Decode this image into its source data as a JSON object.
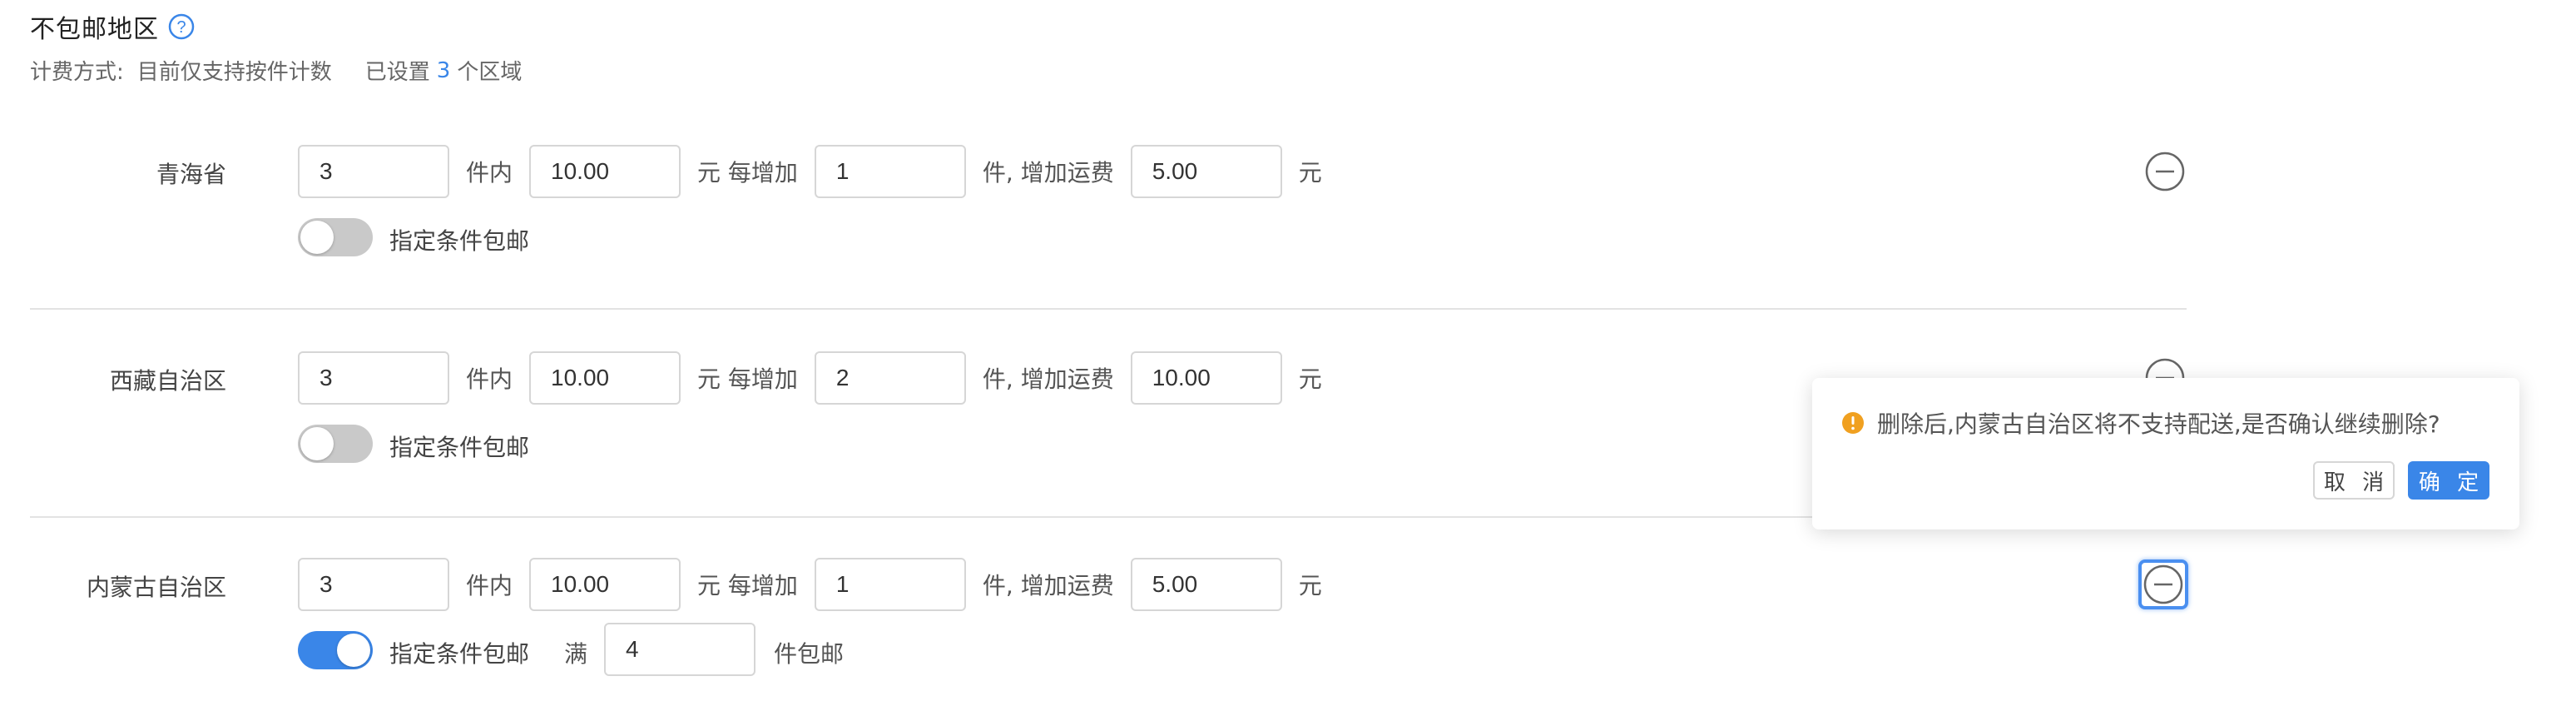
{
  "header": {
    "title": "不包邮地区",
    "help_icon": "question-circle-icon",
    "billing_label": "计费方式:",
    "billing_value": "目前仅支持按件计数",
    "set_prefix": "已设置",
    "set_count": "3",
    "set_suffix": "个区域"
  },
  "labels": {
    "within": "件内",
    "yuan_each": "元 每增加",
    "piece_add": "件, 增加运费",
    "yuan": "元",
    "free_toggle": "指定条件包邮",
    "full": "满",
    "piece_free": "件包邮"
  },
  "regions": [
    {
      "name": "青海省",
      "first_qty": "3",
      "first_fee": "10.00",
      "add_qty": "1",
      "add_fee": "5.00",
      "free_enabled": false
    },
    {
      "name": "西藏自治区",
      "first_qty": "3",
      "first_fee": "10.00",
      "add_qty": "2",
      "add_fee": "10.00",
      "free_enabled": false
    },
    {
      "name": "内蒙古自治区",
      "first_qty": "3",
      "first_fee": "10.00",
      "add_qty": "1",
      "add_fee": "5.00",
      "free_enabled": true,
      "free_qty": "4"
    }
  ],
  "popconfirm": {
    "message": "删除后,内蒙古自治区将不支持配送,是否确认继续删除?",
    "cancel": "取 消",
    "ok": "确 定",
    "icon": "warning-circle-icon"
  },
  "colors": {
    "accent": "#3a86e8",
    "warning": "#f0a020",
    "toggle_off": "#c9c9c9"
  }
}
